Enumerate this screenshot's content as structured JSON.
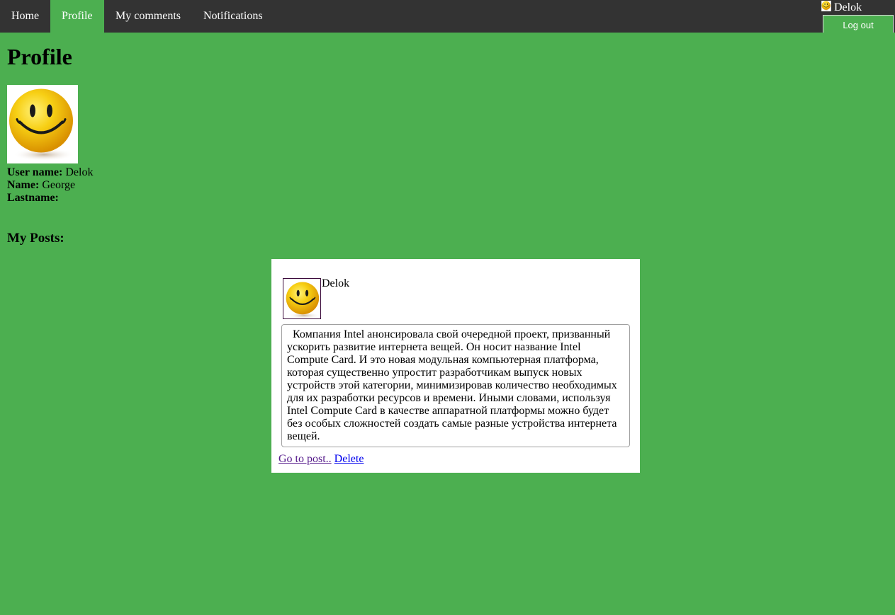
{
  "nav": {
    "items": [
      {
        "label": "Home",
        "active": false
      },
      {
        "label": "Profile",
        "active": true
      },
      {
        "label": "My comments",
        "active": false
      },
      {
        "label": "Notifications",
        "active": false
      }
    ]
  },
  "user_corner": {
    "username": "Delok",
    "avatar_icon": "smiley-icon",
    "logout_label": "Log out"
  },
  "page": {
    "title": "Profile"
  },
  "profile": {
    "avatar_icon": "smiley-icon",
    "username_label": "User name:",
    "username": "Delok",
    "name_label": "Name:",
    "name": "George",
    "lastname_label": "Lastname:",
    "lastname": ""
  },
  "posts": {
    "title": "My Posts:",
    "items": [
      {
        "author": "Delok",
        "avatar_icon": "smiley-icon",
        "body": "Компания Intel анонсировала свой очередной проект, призванный ускорить развитие интернета вещей. Он носит название Intel Compute Card. И это новая модульная компьютерная платформа, которая существенно упростит разработчикам выпуск новых устройств этой категории, минимизировав количество необходимых для их разработки ресурсов и времени. Иными словами, используя Intel Compute Card в качестве аппаратной платформы можно будет без особых сложностей создать самые разные устройства интернета вещей.",
        "goto_label": "Go to post..",
        "delete_label": "Delete"
      }
    ]
  },
  "colors": {
    "page_background": "#4caf50",
    "nav_background": "#333333",
    "nav_active": "#4caf50",
    "smiley_yellow": "#f5c400"
  }
}
